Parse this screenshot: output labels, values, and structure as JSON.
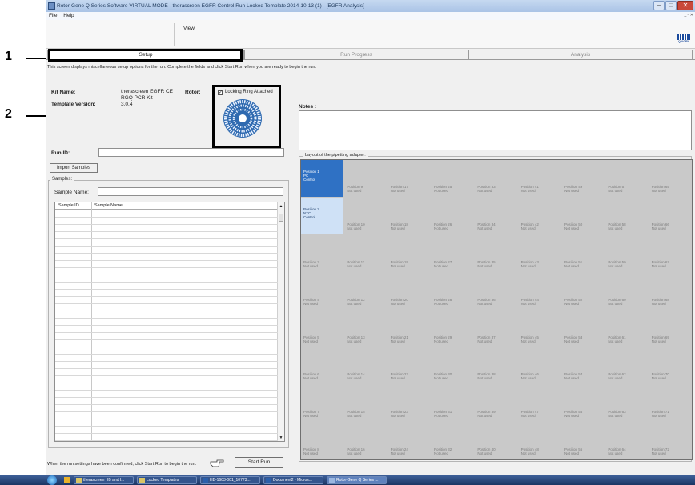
{
  "window": {
    "title": "Rotor-Gene Q Series Software VIRTUAL MODE - therascreen EGFR Control Run Locked Template 2014-10-13 (1) - [EGFR Analysis]",
    "min_label": "–",
    "max_label": "□",
    "close_label": "✕"
  },
  "menu": {
    "file": "File",
    "help": "Help",
    "mdi_buttons": "_ ▫ ✕"
  },
  "toolbar": {
    "view": "View",
    "brand": "QIAGEN"
  },
  "tabs": {
    "setup": "Setup",
    "run_progress": "Run Progress",
    "analysis": "Analysis"
  },
  "setup": {
    "description": "This screen displays miscellaneous setup options for the run. Complete the fields and click Start Run when you are ready to begin the run.",
    "kit_name_label": "Kit Name:",
    "kit_name_line1": "therascreen EGFR CE",
    "kit_name_line2": "RGQ PCR Kit",
    "template_version_label": "Template Version:",
    "template_version": "3.0.4",
    "rotor_label": "Rotor:",
    "locking_ring_label": "Locking Ring Attached",
    "locking_ring_checked": true,
    "notes_label": "Notes :",
    "notes_value": "",
    "run_id_label": "Run ID:",
    "run_id_value": "",
    "import_samples": "Import Samples",
    "samples_group": "Samples:",
    "sample_name_label": "Sample Name:",
    "sample_name_value": "",
    "columns": [
      "Sample ID",
      "Sample Name"
    ],
    "layout_label": "Layout of the pipetting adapter:",
    "confirm_text": "When the run settings have been confirmed, click Start Run to begin the run.",
    "start_run": "Start Run"
  },
  "positions": [
    {
      "name": "Position 1",
      "status": "PC\nControl"
    },
    {
      "name": "Position 9",
      "status": "Not used"
    },
    {
      "name": "Position 17",
      "status": "Not used"
    },
    {
      "name": "Position 25",
      "status": "Not used"
    },
    {
      "name": "Position 33",
      "status": "Not used"
    },
    {
      "name": "Position 41",
      "status": "Not used"
    },
    {
      "name": "Position 49",
      "status": "Not used"
    },
    {
      "name": "Position 57",
      "status": "Not used"
    },
    {
      "name": "Position 65",
      "status": "Not used"
    },
    {
      "name": "Position 2",
      "status": "NTC\nControl"
    },
    {
      "name": "Position 10",
      "status": "Not used"
    },
    {
      "name": "Position 18",
      "status": "Not used"
    },
    {
      "name": "Position 26",
      "status": "Not used"
    },
    {
      "name": "Position 34",
      "status": "Not used"
    },
    {
      "name": "Position 42",
      "status": "Not used"
    },
    {
      "name": "Position 50",
      "status": "Not used"
    },
    {
      "name": "Position 58",
      "status": "Not used"
    },
    {
      "name": "Position 66",
      "status": "Not used"
    },
    {
      "name": "Position 3",
      "status": "Not used"
    },
    {
      "name": "Position 11",
      "status": "Not used"
    },
    {
      "name": "Position 19",
      "status": "Not used"
    },
    {
      "name": "Position 27",
      "status": "Not used"
    },
    {
      "name": "Position 35",
      "status": "Not used"
    },
    {
      "name": "Position 43",
      "status": "Not used"
    },
    {
      "name": "Position 51",
      "status": "Not used"
    },
    {
      "name": "Position 59",
      "status": "Not used"
    },
    {
      "name": "Position 67",
      "status": "Not used"
    },
    {
      "name": "Position 4",
      "status": "Not used"
    },
    {
      "name": "Position 12",
      "status": "Not used"
    },
    {
      "name": "Position 20",
      "status": "Not used"
    },
    {
      "name": "Position 28",
      "status": "Not used"
    },
    {
      "name": "Position 36",
      "status": "Not used"
    },
    {
      "name": "Position 44",
      "status": "Not used"
    },
    {
      "name": "Position 52",
      "status": "Not used"
    },
    {
      "name": "Position 60",
      "status": "Not used"
    },
    {
      "name": "Position 68",
      "status": "Not used"
    },
    {
      "name": "Position 5",
      "status": "Not used"
    },
    {
      "name": "Position 13",
      "status": "Not used"
    },
    {
      "name": "Position 21",
      "status": "Not used"
    },
    {
      "name": "Position 29",
      "status": "Not used"
    },
    {
      "name": "Position 37",
      "status": "Not used"
    },
    {
      "name": "Position 45",
      "status": "Not used"
    },
    {
      "name": "Position 53",
      "status": "Not used"
    },
    {
      "name": "Position 61",
      "status": "Not used"
    },
    {
      "name": "Position 69",
      "status": "Not used"
    },
    {
      "name": "Position 6",
      "status": "Not used"
    },
    {
      "name": "Position 14",
      "status": "Not used"
    },
    {
      "name": "Position 22",
      "status": "Not used"
    },
    {
      "name": "Position 30",
      "status": "Not used"
    },
    {
      "name": "Position 38",
      "status": "Not used"
    },
    {
      "name": "Position 46",
      "status": "Not used"
    },
    {
      "name": "Position 54",
      "status": "Not used"
    },
    {
      "name": "Position 62",
      "status": "Not used"
    },
    {
      "name": "Position 70",
      "status": "Not used"
    },
    {
      "name": "Position 7",
      "status": "Not used"
    },
    {
      "name": "Position 15",
      "status": "Not used"
    },
    {
      "name": "Position 23",
      "status": "Not used"
    },
    {
      "name": "Position 31",
      "status": "Not used"
    },
    {
      "name": "Position 39",
      "status": "Not used"
    },
    {
      "name": "Position 47",
      "status": "Not used"
    },
    {
      "name": "Position 55",
      "status": "Not used"
    },
    {
      "name": "Position 63",
      "status": "Not used"
    },
    {
      "name": "Position 71",
      "status": "Not used"
    },
    {
      "name": "Position 8",
      "status": "Not used"
    },
    {
      "name": "Position 16",
      "status": "Not used"
    },
    {
      "name": "Position 24",
      "status": "Not used"
    },
    {
      "name": "Position 32",
      "status": "Not used"
    },
    {
      "name": "Position 40",
      "status": "Not used"
    },
    {
      "name": "Position 48",
      "status": "Not used"
    },
    {
      "name": "Position 56",
      "status": "Not used"
    },
    {
      "name": "Position 64",
      "status": "Not used"
    },
    {
      "name": "Position 72",
      "status": "Not used"
    }
  ],
  "taskbar": {
    "items": [
      "therascreen HB and I...",
      "Locked Templates",
      "HB-1603-001_10773...",
      "Document2 - Micros...",
      "Rotor-Gene Q Series ..."
    ]
  },
  "callouts": [
    "1",
    "2"
  ],
  "colors": {
    "pc_cell": "#2f71c4",
    "ntc_cell": "#cfe1f6",
    "empty_cell": "#c9c9c9"
  }
}
